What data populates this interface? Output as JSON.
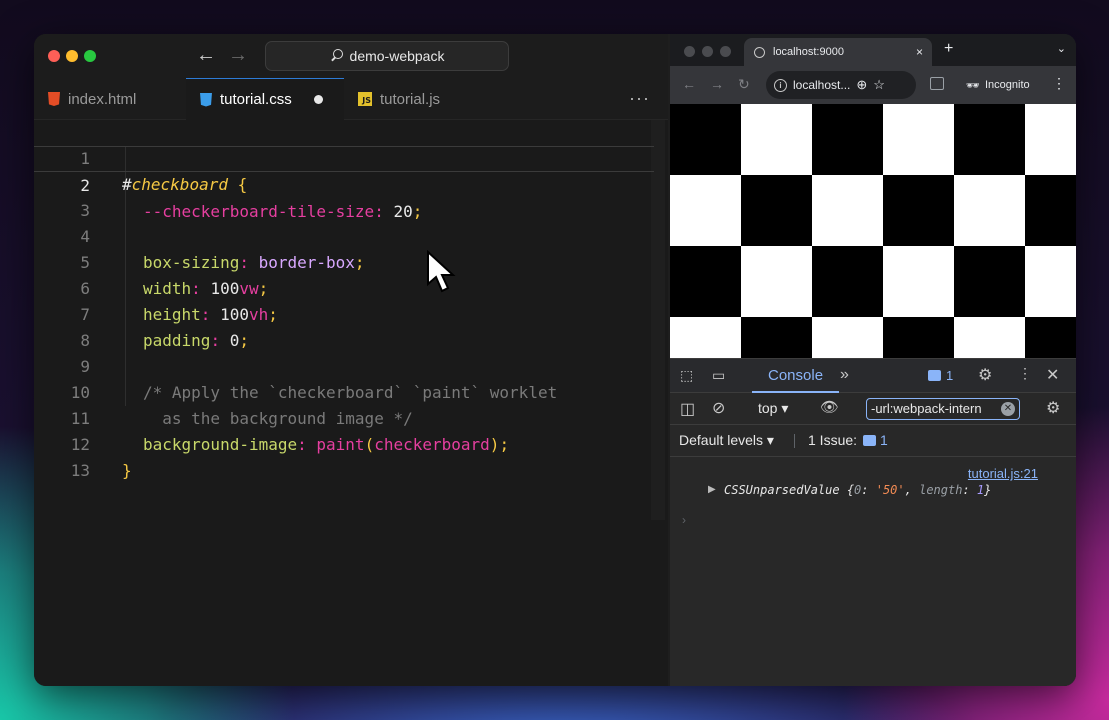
{
  "editor": {
    "search_text": "demo-webpack",
    "tabs": [
      {
        "label": "index.html"
      },
      {
        "label": "tutorial.css"
      },
      {
        "label": "tutorial.js"
      }
    ],
    "more_label": "···",
    "line_numbers": [
      "1",
      "2",
      "3",
      "4",
      "5",
      "6",
      "7",
      "8",
      "9",
      "10",
      "11",
      "12",
      "13"
    ],
    "code": {
      "l1_hash": "#",
      "l1_selector": "checkboard",
      "l1_brace": " {",
      "l2_var": "--checkerboard-tile-size",
      "l2_colon": ": ",
      "l2_value": "20",
      "l2_semi": ";",
      "l4_prop": "box-sizing",
      "l4_colon": ": ",
      "l4_value": "border-box",
      "l4_semi": ";",
      "l5_prop": "width",
      "l5_colon": ": ",
      "l5_num": "100",
      "l5_unit": "vw",
      "l5_semi": ";",
      "l6_prop": "height",
      "l6_colon": ": ",
      "l6_num": "100",
      "l6_unit": "vh",
      "l6_semi": ";",
      "l7_prop": "padding",
      "l7_colon": ": ",
      "l7_num": "0",
      "l7_semi": ";",
      "l9_comment": "/* Apply the `checkerboard` `paint` worklet",
      "l10_comment": "  as the background image */",
      "l11_prop": "background-image",
      "l11_colon": ": ",
      "l11_fn": "paint",
      "l11_open": "(",
      "l11_arg": "checkerboard",
      "l11_close": ")",
      "l11_semi": ";",
      "l12_brace": "}"
    }
  },
  "browser": {
    "tab_title": "localhost:9000",
    "tab_close": "×",
    "new_tab": "+",
    "url": "localhost...",
    "incognito_label": "Incognito"
  },
  "devtools": {
    "console_tab": "Console",
    "badge_count": "1",
    "context": "top",
    "filter_value": "-url:webpack-intern",
    "levels_label": "Default levels ▾",
    "issues_label": "1 Issue:",
    "issues_count": "1",
    "log_source": "tutorial.js:21",
    "log_type": "CSSUnparsedValue",
    "log_open": " {",
    "log_key0": "0",
    "log_colon": ": ",
    "log_val0": "'50'",
    "log_comma": ", ",
    "log_key_len": "length",
    "log_len": "1",
    "log_close": "}"
  },
  "colors": {
    "accent": "#2d7bd6",
    "pink": "#e63fa0",
    "yellow": "#f6c944",
    "purple": "#d8a8ff",
    "devtools_blue": "#8ab4f8"
  }
}
